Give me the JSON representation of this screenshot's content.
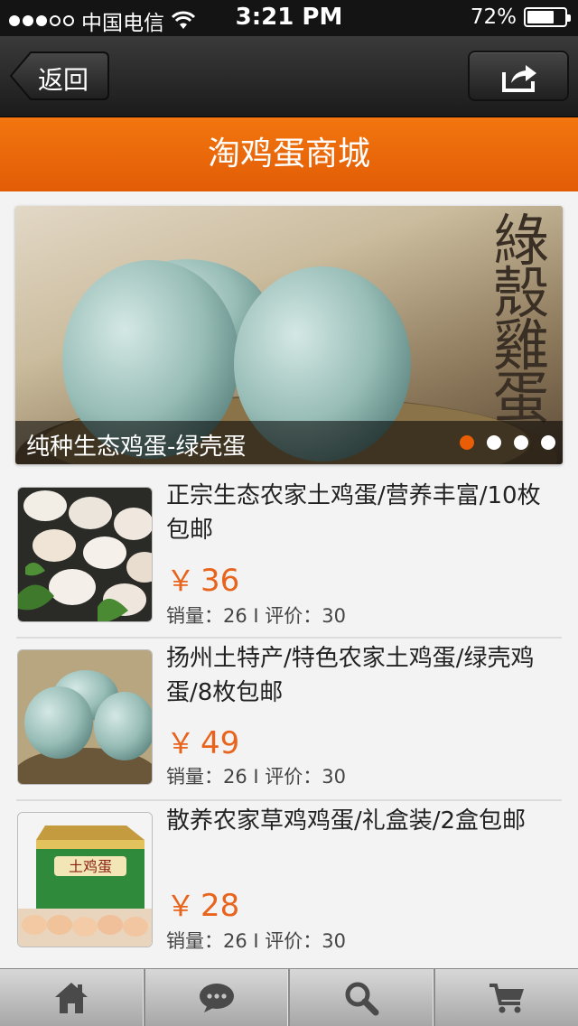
{
  "status_bar": {
    "carrier": "中国电信",
    "time": "3:21 PM",
    "battery": "72%",
    "battery_level": 0.72,
    "signal_bars": 3
  },
  "nav": {
    "back_label": "返回",
    "share_icon": "share-icon"
  },
  "page_title": "淘鸡蛋商城",
  "banner": {
    "slogan": [
      "綠",
      "殼",
      "雞",
      "蛋"
    ],
    "caption": "纯种生态鸡蛋-绿壳蛋",
    "slides": 4,
    "active_slide": 1
  },
  "products": [
    {
      "title": "正宗生态农家土鸡蛋/营养丰富/10枚包邮",
      "price_symbol": "￥",
      "price": "36",
      "meta": "销量：26 I 评价：30"
    },
    {
      "title": "扬州土特产/特色农家土鸡蛋/绿壳鸡蛋/8枚包邮",
      "price_symbol": "￥",
      "price": "49",
      "meta": "销量：26 I 评价：30"
    },
    {
      "title": "散养农家草鸡鸡蛋/礼盒装/2盒包邮",
      "price_symbol": "￥",
      "price": "28",
      "meta": "销量：26 I 评价：30",
      "box_label": "土鸡蛋"
    }
  ],
  "tabbar": {
    "items": [
      "home-icon",
      "chat-icon",
      "search-icon",
      "cart-icon"
    ]
  },
  "colors": {
    "accent": "#e8631c",
    "title_bar": "#ee6c0b",
    "pager_active": "#e85d05"
  }
}
